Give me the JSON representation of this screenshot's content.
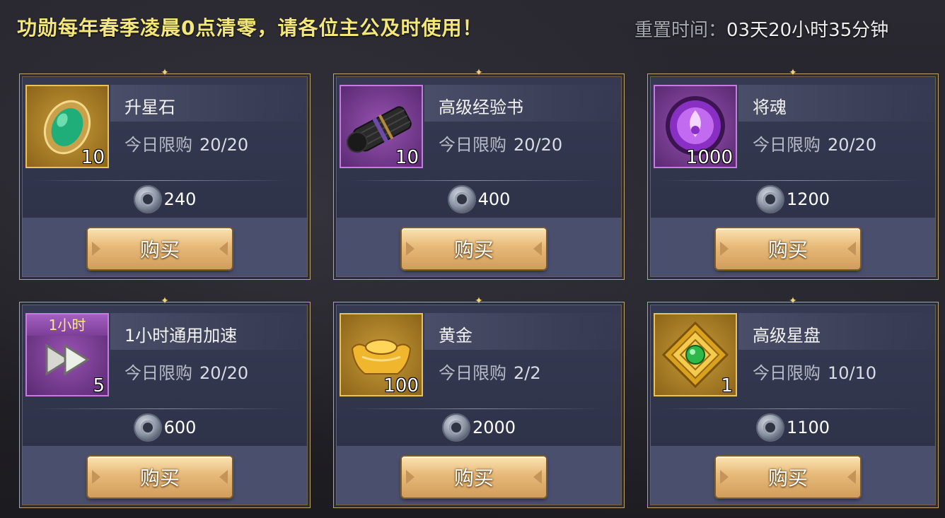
{
  "header": {
    "notice": "功勋每年春季凌晨0点清零，请各位主公及时使用！",
    "reset_label": "重置时间：",
    "reset_value": "03天20小时35分钟"
  },
  "buy_label": "购买",
  "limit_label": "今日限购",
  "items": [
    {
      "name": "升星石",
      "qty": "10",
      "limit": "20/20",
      "price": "240",
      "icon": "green-gem-icon"
    },
    {
      "name": "高级经验书",
      "qty": "10",
      "limit": "20/20",
      "price": "400",
      "icon": "scroll-bundle-icon"
    },
    {
      "name": "将魂",
      "qty": "1000",
      "limit": "20/20",
      "price": "1200",
      "icon": "purple-soul-orb-icon"
    },
    {
      "name": "1小时通用加速",
      "qty": "5",
      "limit": "20/20",
      "price": "600",
      "icon": "speedup-arrows-icon",
      "tag": "1小时"
    },
    {
      "name": "黄金",
      "qty": "100",
      "limit": "2/2",
      "price": "2000",
      "icon": "gold-ingot-icon"
    },
    {
      "name": "高级星盘",
      "qty": "1",
      "limit": "10/10",
      "price": "1100",
      "icon": "star-plate-icon"
    }
  ],
  "colors": {
    "notice": "#f4e77a",
    "card_border": "#bfa56a",
    "button": "#e7b978"
  }
}
